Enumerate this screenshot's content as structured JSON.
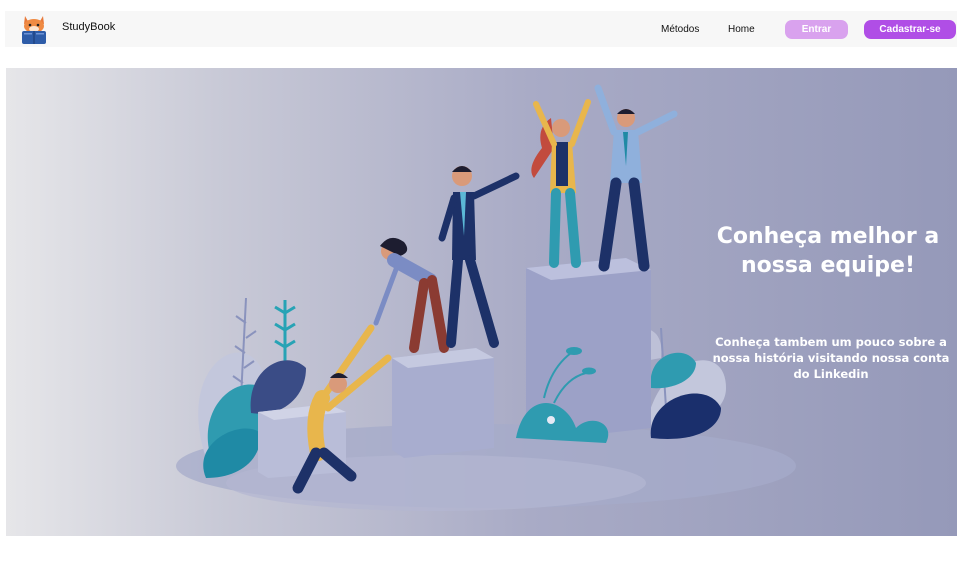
{
  "navbar": {
    "brand": "StudyBook",
    "links": [
      "Métodos",
      "Home"
    ],
    "login_label": "Entrar",
    "signup_label": "Cadastrar-se"
  },
  "hero": {
    "title": "Conheça melhor a nossa equipe!",
    "subtitle": "Conheça tambem um pouco sobre a nossa história visitando nossa conta do Linkedin"
  },
  "colors": {
    "login_button": "#d9a2ee",
    "signup_button": "#b04ee6",
    "hero_gradient_start": "#e6e6e9",
    "hero_gradient_end": "#9599b9"
  },
  "icons": [
    "fox-reading-book-logo",
    "team-climbing-podium-illustration"
  ]
}
